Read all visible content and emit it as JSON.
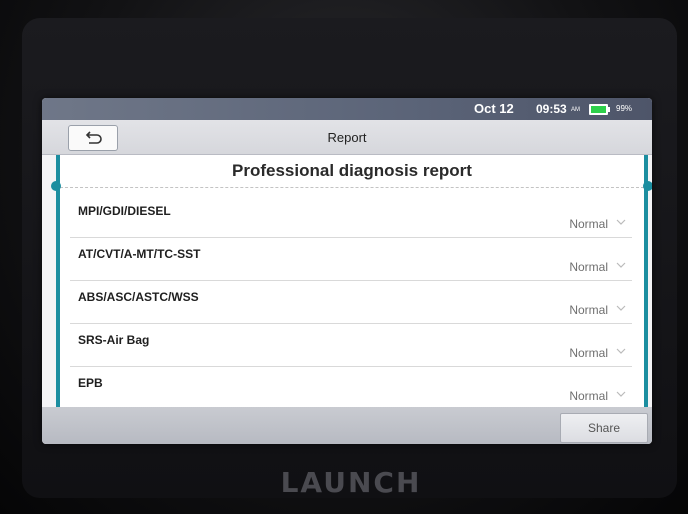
{
  "device": {
    "brand": "LAUNCH"
  },
  "status_bar": {
    "date": "Oct 12",
    "time": "09:53",
    "ampm": "AM",
    "battery_percent": "99%",
    "battery_level": 0.99,
    "battery_color": "#2ed04b"
  },
  "header": {
    "title": "Report",
    "back_icon": "back-arrow-icon"
  },
  "report": {
    "title": "Professional diagnosis report",
    "items": [
      {
        "label": "MPI/GDI/DIESEL",
        "status": "Normal"
      },
      {
        "label": "AT/CVT/A-MT/TC-SST",
        "status": "Normal"
      },
      {
        "label": "ABS/ASC/ASTC/WSS",
        "status": "Normal"
      },
      {
        "label": "SRS-Air Bag",
        "status": "Normal"
      },
      {
        "label": "EPB",
        "status": "Normal"
      }
    ]
  },
  "footer": {
    "share_label": "Share"
  },
  "colors": {
    "accent": "#1c8ea0"
  }
}
